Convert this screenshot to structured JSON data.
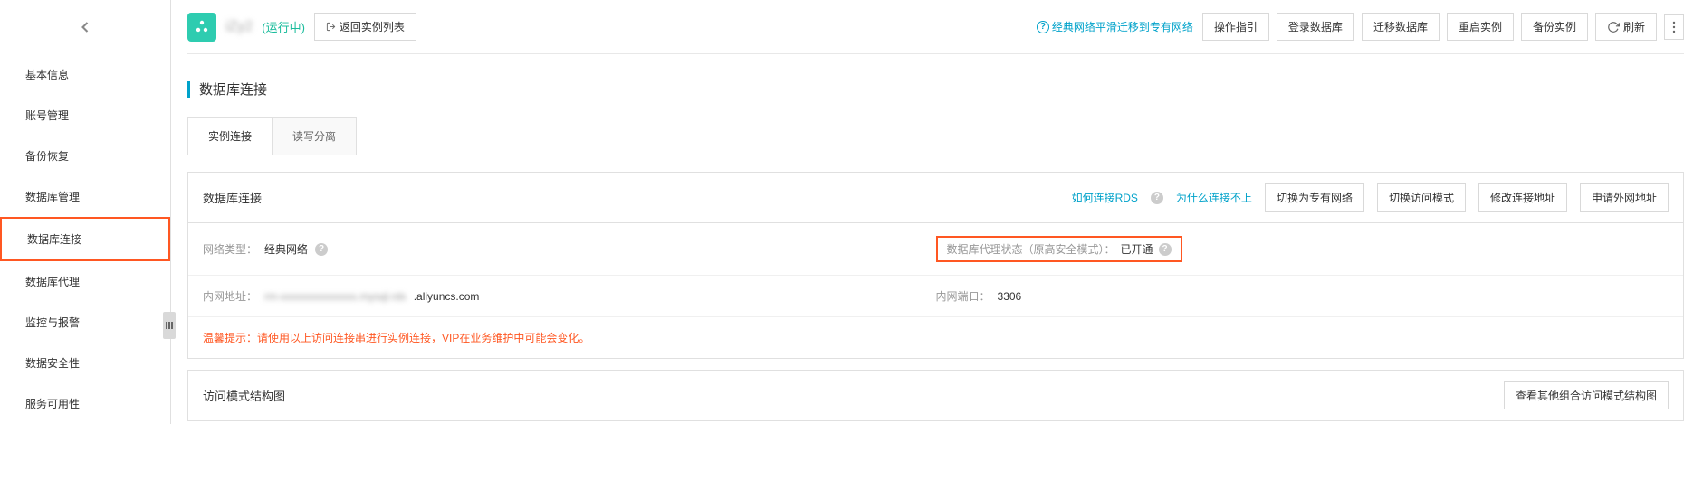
{
  "sidebar": {
    "items": [
      {
        "label": "基本信息"
      },
      {
        "label": "账号管理"
      },
      {
        "label": "备份恢复"
      },
      {
        "label": "数据库管理"
      },
      {
        "label": "数据库连接",
        "active": true
      },
      {
        "label": "数据库代理"
      },
      {
        "label": "监控与报警"
      },
      {
        "label": "数据安全性"
      },
      {
        "label": "服务可用性"
      }
    ]
  },
  "header": {
    "instance_name": "iZy2",
    "status": "(运行中)",
    "back_button": "返回实例列表",
    "migrate_link": "经典网络平滑迁移到专有网络",
    "actions": {
      "guide": "操作指引",
      "login_db": "登录数据库",
      "migrate_db": "迁移数据库",
      "restart": "重启实例",
      "backup": "备份实例",
      "refresh": "刷新"
    }
  },
  "section": {
    "title": "数据库连接"
  },
  "tabs": {
    "t1": "实例连接",
    "t2": "读写分离"
  },
  "conn_panel": {
    "title": "数据库连接",
    "links": {
      "how_connect": "如何连接RDS",
      "why_fail": "为什么连接不上",
      "switch_vpc": "切换为专有网络",
      "switch_mode": "切换访问模式",
      "modify_addr": "修改连接地址",
      "apply_extnet": "申请外网地址"
    },
    "row1": {
      "left_label": "网络类型：",
      "left_value": "经典网络",
      "right_label": "数据库代理状态（原高安全模式）：",
      "right_value": "已开通"
    },
    "row2": {
      "left_label": "内网地址：",
      "left_value_blur": "rm-xxxxxxxxxxxxxx.mysql.rds",
      "left_value_suffix": ".aliyuncs.com",
      "right_label": "内网端口：",
      "right_value": "3306"
    },
    "warning": "温馨提示：请使用以上访问连接串进行实例连接，VIP在业务维护中可能会变化。"
  },
  "struct_panel": {
    "title": "访问模式结构图",
    "view_other": "查看其他组合访问模式结构图"
  }
}
